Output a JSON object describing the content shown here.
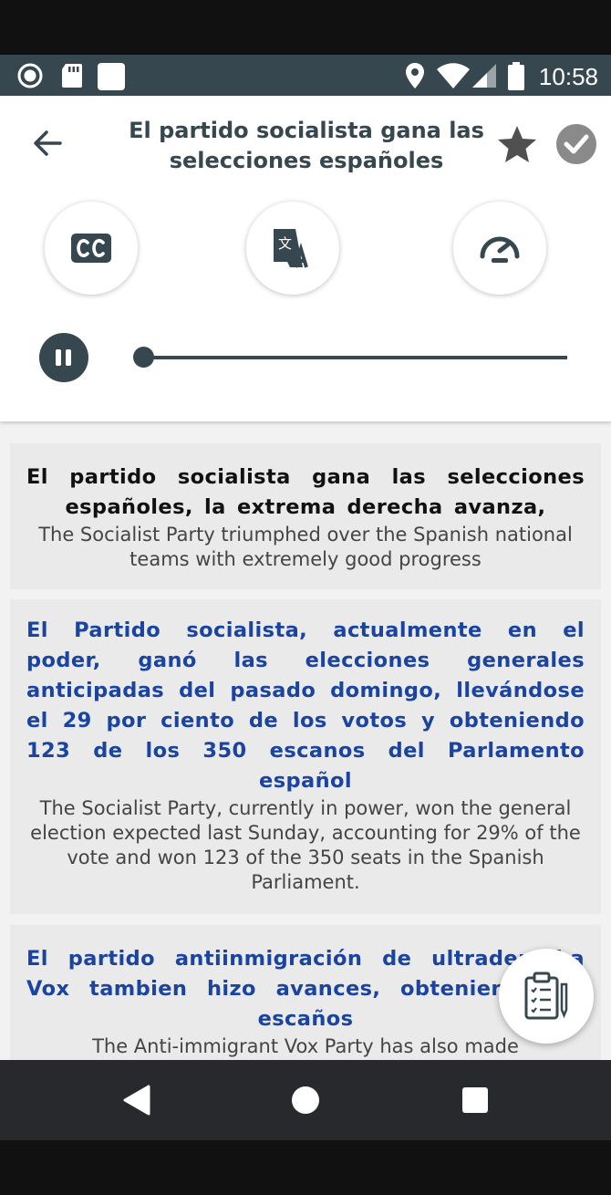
{
  "status_bar": {
    "time": "10:58",
    "left_icons": [
      "record-icon",
      "sd-card-icon",
      "notification-square-icon"
    ],
    "right_icons": [
      "location-icon",
      "wifi-icon",
      "signal-icon",
      "battery-icon"
    ]
  },
  "header": {
    "title": "El partido socialista gana las selecciones españoles",
    "back_icon": "arrow-left-icon",
    "favorite_icon": "star-icon",
    "done_icon": "check-circle-icon"
  },
  "controls": {
    "buttons": [
      {
        "icon": "closed-captions-icon"
      },
      {
        "icon": "translate-icon"
      },
      {
        "icon": "speedometer-icon"
      }
    ],
    "player": {
      "state_icon": "pause-icon",
      "progress": 0.0
    }
  },
  "sentences": [
    {
      "spanish": "El partido socialista gana las selecciones españoles, la extrema derecha avanza,",
      "english": "The Socialist Party triumphed over the Spanish national teams with extremely good progress",
      "spanish_color": "#111111"
    },
    {
      "spanish": "El Partido socialista, actualmente en el poder, ganó las elecciones generales anticipadas del pasado domingo, llevándose el 29 por ciento de los votos y obteniendo 123 de los 350 escanos del Parlamento español",
      "english": "The Socialist Party, currently in power, won the general election expected last Sunday, accounting for 29% of the vote and won 123 of the 350 seats in the Spanish Parliament.",
      "spanish_color": "#1a44a0"
    },
    {
      "spanish": "El partido antiinmigración de ultraderecha Vox tambien hizo avances, obteniendo 24 escaños",
      "english": "The Anti-immigrant Vox Party has also made",
      "spanish_color": "#1a44a0"
    }
  ],
  "fab": {
    "icon": "clipboard-checklist-icon"
  },
  "nav_bar": {
    "icons": [
      "back-triangle-icon",
      "home-circle-icon",
      "recents-square-icon"
    ]
  },
  "colors": {
    "primary": "#37474f",
    "highlight_text": "#1a44a0",
    "card_background": "#eaeaea",
    "nav_bar": "#27292c"
  }
}
